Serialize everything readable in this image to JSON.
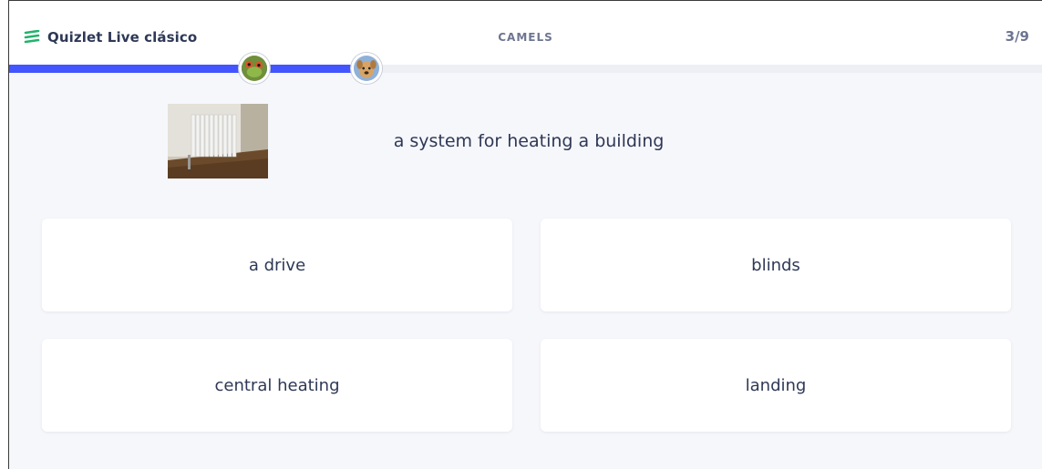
{
  "header": {
    "app_name": "Quizlet Live clásico",
    "team_name": "CAMELS",
    "progress": "3/9"
  },
  "team_progress": {
    "fraction": 0.333,
    "fill_color": "#4255ff"
  },
  "players": [
    {
      "avatar": "frog-avatar-icon"
    },
    {
      "avatar": "dog-avatar-icon"
    }
  ],
  "question": {
    "prompt": "a system for heating a building",
    "image": "radiator-photo"
  },
  "answers": [
    {
      "label": "a drive"
    },
    {
      "label": "blinds"
    },
    {
      "label": "central heating"
    },
    {
      "label": "landing"
    }
  ],
  "colors": {
    "brand": "#4255ff",
    "brand_logo": "#23b26d",
    "text": "#2e3856",
    "background": "#f6f7fb"
  }
}
